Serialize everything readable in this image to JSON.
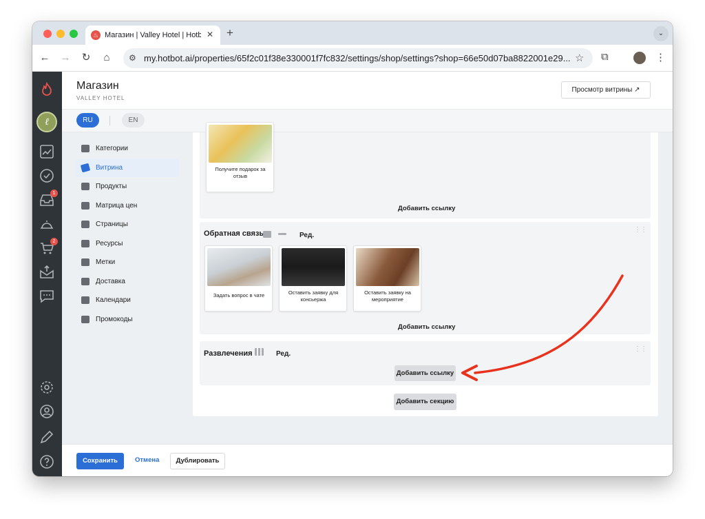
{
  "browser": {
    "tab_title": "Магазин | Valley Hotel | Hotbot",
    "url": "my.hotbot.ai/properties/65f2c01f38e330001f7fc832/settings/shop/settings?shop=66e50d07ba8822001e29..."
  },
  "header": {
    "title": "Магазин",
    "subtitle": "VALLEY HOTEL",
    "preview_label": "Просмотр витрины",
    "preview_icon": "↗"
  },
  "languages": {
    "ru": "RU",
    "en": "EN"
  },
  "rail": {
    "inbox_badge": "1",
    "cart_badge": "2"
  },
  "sidebar": {
    "items": [
      {
        "label": "Категории",
        "icon": "store-icon"
      },
      {
        "label": "Витрина",
        "icon": "tag-icon"
      },
      {
        "label": "Продукты",
        "icon": "grid-icon"
      },
      {
        "label": "Матрица цен",
        "icon": "calculator-icon"
      },
      {
        "label": "Страницы",
        "icon": "page-icon"
      },
      {
        "label": "Ресурсы",
        "icon": "resource-icon"
      },
      {
        "label": "Метки",
        "icon": "label-icon"
      },
      {
        "label": "Доставка",
        "icon": "truck-icon"
      },
      {
        "label": "Календари",
        "icon": "calendar-icon"
      },
      {
        "label": "Промокоды",
        "icon": "promo-icon"
      }
    ]
  },
  "sections": {
    "top": {
      "card_label": "Получите подарок за отзыв",
      "add_link": "Добавить ссылку"
    },
    "feedback": {
      "title": "Обратная связь",
      "edit": "Ред.",
      "cards": [
        {
          "label": "Задать вопрос в чате"
        },
        {
          "label": "Оставить заявку для консьержа"
        },
        {
          "label": "Оставить заявку на мероприятие"
        }
      ],
      "add_link": "Добавить ссылку"
    },
    "entertainment": {
      "title": "Развлечения",
      "edit": "Ред.",
      "add_link": "Добавить ссылку"
    },
    "add_section": "Добавить секцию"
  },
  "footer": {
    "save": "Сохранить",
    "cancel": "Отмена",
    "duplicate": "Дублировать"
  },
  "colors": {
    "accent": "#2b6fd6",
    "rail": "#2f3439",
    "annotation_arrow": "#e8321e"
  }
}
